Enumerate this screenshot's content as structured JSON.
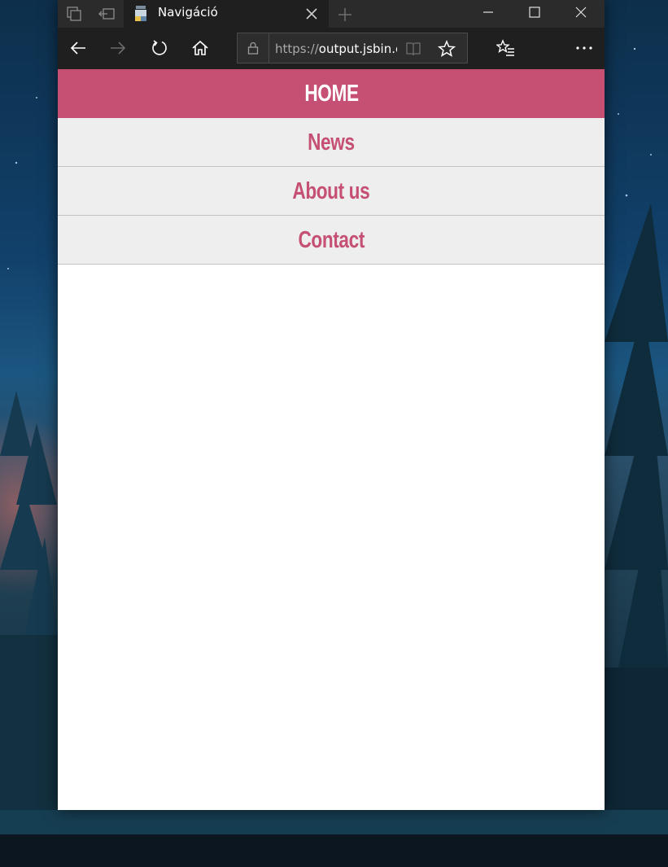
{
  "browser": {
    "tab_title": "Navigáció",
    "url_protocol": "https://",
    "url_rest": "output.jsbin.c",
    "icons": [
      "tab-manager-icon",
      "set-aside-tabs-icon",
      "close-icon",
      "new-tab-icon",
      "minimize-icon",
      "maximize-icon",
      "close-window-icon",
      "back-icon",
      "forward-icon",
      "refresh-icon",
      "home-icon",
      "lock-icon",
      "reading-view-icon",
      "favorite-star-icon",
      "favorites-list-icon",
      "more-icon"
    ]
  },
  "page": {
    "menu": [
      {
        "label": "HOME",
        "active": true
      },
      {
        "label": "News",
        "active": false
      },
      {
        "label": "About us",
        "active": false
      },
      {
        "label": "Contact",
        "active": false
      }
    ]
  },
  "colors": {
    "accent": "#c55073",
    "menu_bg": "#eeeeee",
    "chrome_dark": "#1f1f1f"
  }
}
